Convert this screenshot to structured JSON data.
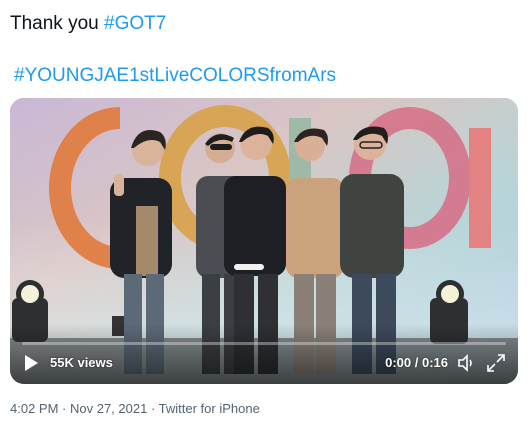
{
  "tweet": {
    "line1_text": "Thank you ",
    "hashtag1": "#GOT7",
    "hashtag2": "#YOUNGJAE1stLiveCOLORSfromArs"
  },
  "media": {
    "views": "55K views",
    "time": "0:00 / 0:16",
    "progress": 0,
    "backdrop_text": "COLORS",
    "icons": [
      "play-icon",
      "volume-icon",
      "fullscreen-icon"
    ]
  },
  "meta": {
    "time": "4:02 PM",
    "sep1": " · ",
    "date": "Nov 27, 2021",
    "sep2": " · ",
    "source": "Twitter for iPhone"
  },
  "colors": {
    "hashtag": "#1d9bf0",
    "text": "#0f1419",
    "meta": "#536471"
  }
}
